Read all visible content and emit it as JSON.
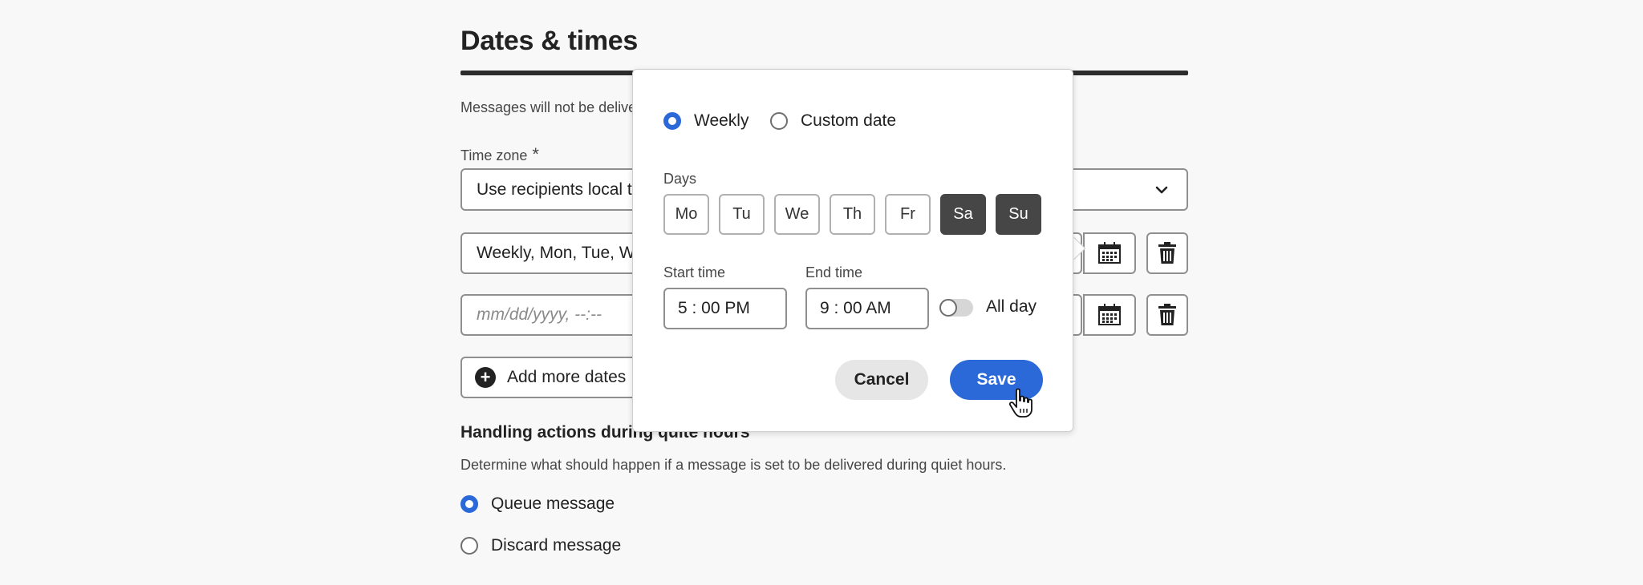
{
  "page": {
    "title": "Dates & times",
    "description": "Messages will not be delive",
    "timezone_label": "Time zone",
    "timezone_required": "*",
    "timezone_value": "Use recipients local ti",
    "schedule_value": "Weekly, Mon, Tue, We",
    "date_placeholder": "mm/dd/yyyy, --:--",
    "add_more_label": "Add more dates",
    "add_more_icon": "+",
    "section_title": "Handling actions during quite hours",
    "section_desc": "Determine what should happen if a message is set to be delivered during quiet hours.",
    "options": [
      {
        "label": "Queue message",
        "selected": true
      },
      {
        "label": "Discard message",
        "selected": false
      }
    ]
  },
  "popover": {
    "mode_options": [
      {
        "label": "Weekly",
        "selected": true
      },
      {
        "label": "Custom date",
        "selected": false
      }
    ],
    "days_label": "Days",
    "days": [
      {
        "label": "Mo",
        "selected": false
      },
      {
        "label": "Tu",
        "selected": false
      },
      {
        "label": "We",
        "selected": false
      },
      {
        "label": "Th",
        "selected": false
      },
      {
        "label": "Fr",
        "selected": false
      },
      {
        "label": "Sa",
        "selected": true
      },
      {
        "label": "Su",
        "selected": true
      }
    ],
    "start_label": "Start time",
    "start_value": "5 : 00 PM",
    "end_label": "End time",
    "end_value": "9 : 00 AM",
    "allday_label": "All day",
    "allday_on": false,
    "cancel_label": "Cancel",
    "save_label": "Save"
  },
  "colors": {
    "accent": "#2b68d8",
    "selected_day": "#464646",
    "background": "#f8f8f8"
  },
  "icons": [
    "chevron-down-icon",
    "calendar-icon",
    "trash-icon",
    "plus-icon",
    "hand-cursor-icon"
  ]
}
